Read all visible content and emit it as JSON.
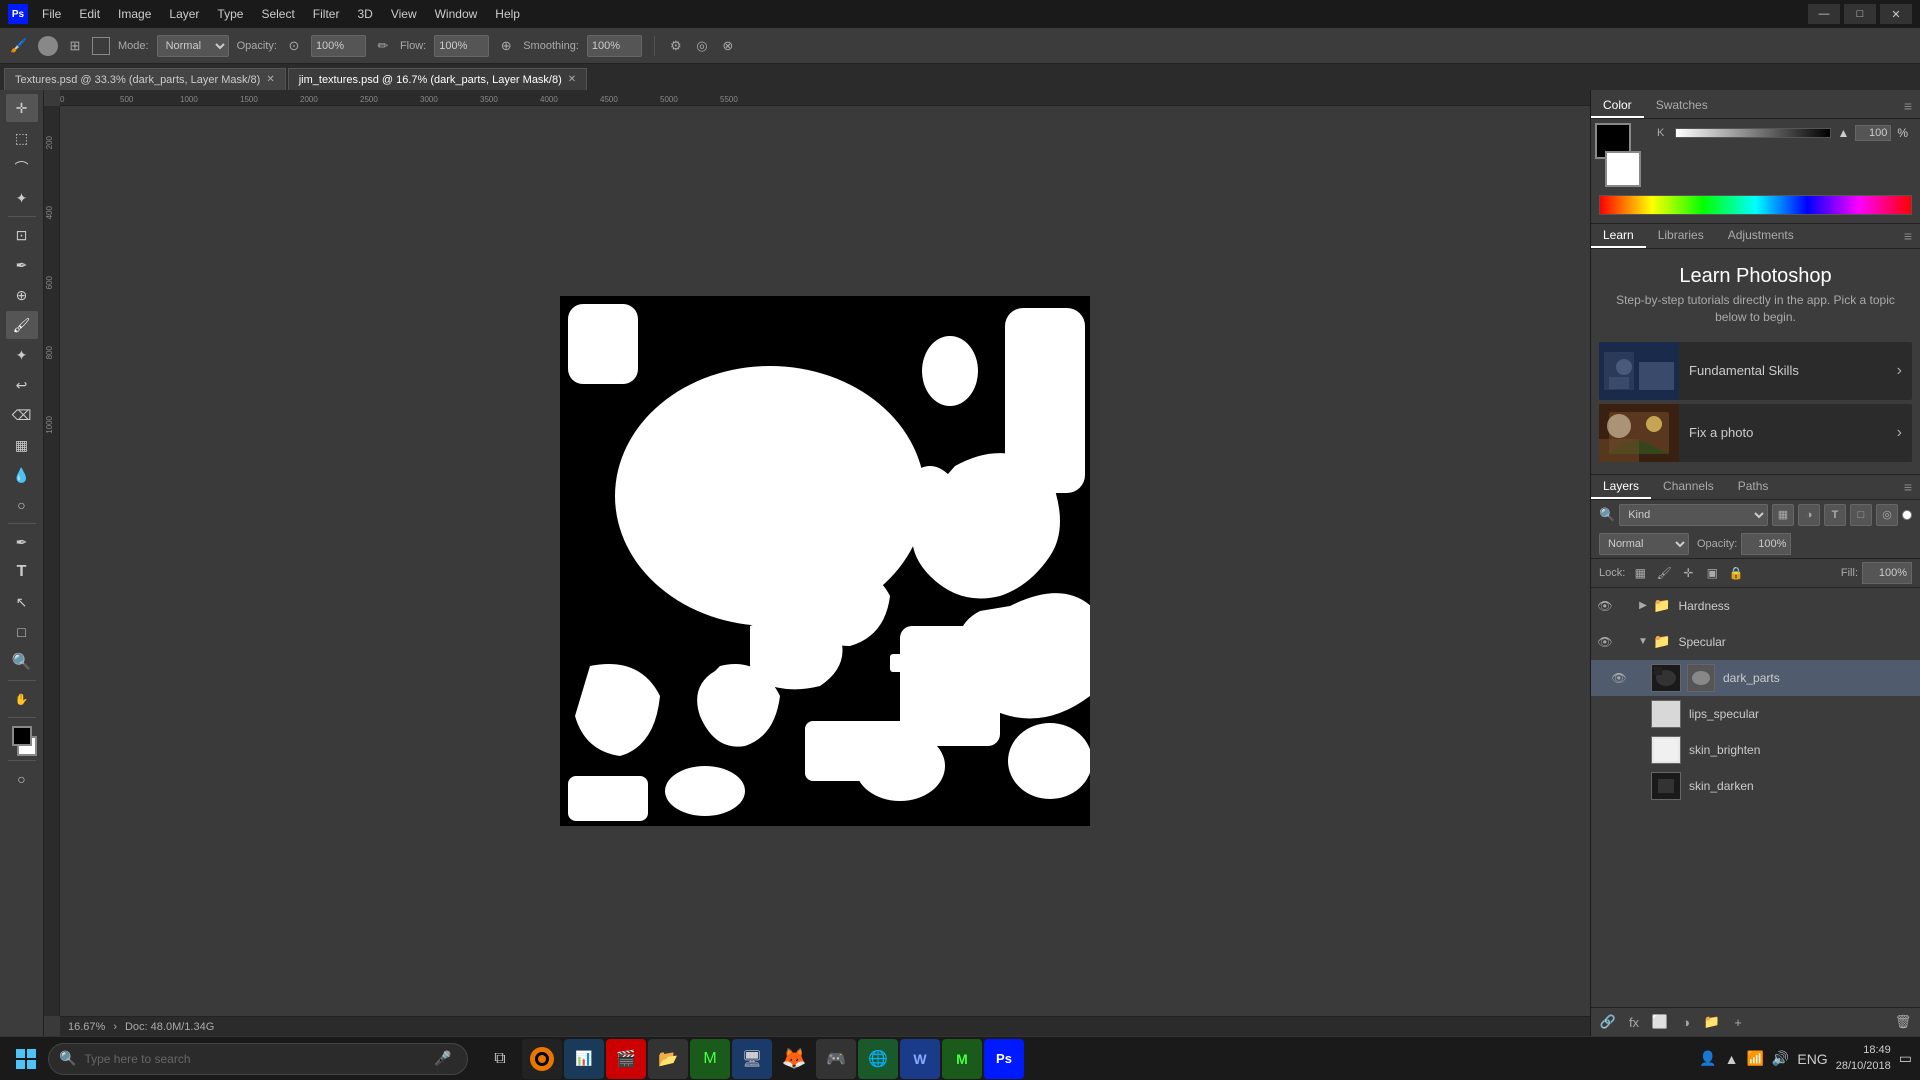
{
  "app": {
    "title": "Adobe Photoshop",
    "logo": "Ps"
  },
  "menus": [
    "File",
    "Edit",
    "Image",
    "Layer",
    "Type",
    "Select",
    "Filter",
    "3D",
    "View",
    "Window",
    "Help"
  ],
  "titlebar": {
    "minimize": "—",
    "maximize": "□",
    "close": "✕"
  },
  "optionsbar": {
    "mode_label": "Mode:",
    "mode_value": "Normal",
    "opacity_label": "Opacity:",
    "opacity_value": "100%",
    "flow_label": "Flow:",
    "flow_value": "100%",
    "smoothing_label": "Smoothing:",
    "smoothing_value": "100%"
  },
  "tabs": [
    {
      "name": "Textures.psd @ 33.3% (dark_parts, Layer Mask/8)",
      "active": false,
      "dirty": false
    },
    {
      "name": "jim_textures.psd @ 16.7% (dark_parts, Layer Mask/8)",
      "active": true,
      "dirty": true
    }
  ],
  "color_panel": {
    "tabs": [
      "Color",
      "Swatches"
    ],
    "active_tab": "Color",
    "k_label": "K",
    "k_value": "100",
    "percent": "%"
  },
  "learn_panel": {
    "tabs": [
      "Learn",
      "Libraries",
      "Adjustments"
    ],
    "active_tab": "Learn",
    "title": "Learn Photoshop",
    "subtitle": "Step-by-step tutorials directly in the app. Pick a topic below to begin.",
    "cards": [
      {
        "id": "fundamental",
        "label": "Fundamental Skills",
        "emoji": "🏠"
      },
      {
        "id": "fix-photo",
        "label": "Fix a photo",
        "emoji": "📷"
      }
    ]
  },
  "layers_panel": {
    "tabs": [
      "Layers",
      "Channels",
      "Paths"
    ],
    "active_tab": "Layers",
    "filter_label": "Kind",
    "mode": "Normal",
    "opacity_label": "Opacity:",
    "opacity_value": "100%",
    "lock_label": "Lock:",
    "fill_label": "Fill:",
    "fill_value": "100%",
    "layers": [
      {
        "id": "hardness",
        "name": "Hardness",
        "type": "group",
        "visible": true,
        "expanded": false,
        "indent": 0
      },
      {
        "id": "specular",
        "name": "Specular",
        "type": "group",
        "visible": true,
        "expanded": true,
        "indent": 0
      },
      {
        "id": "dark_parts",
        "name": "dark_parts",
        "type": "layer",
        "visible": true,
        "selected": true,
        "indent": 1,
        "thumb_color": "#222",
        "mask_color": "#888"
      },
      {
        "id": "lips_specular",
        "name": "lips_specular",
        "type": "layer",
        "visible": true,
        "indent": 1,
        "thumb_color": "#ddd",
        "mask_color": null
      },
      {
        "id": "skin_brighten",
        "name": "skin_brighten",
        "type": "layer",
        "visible": true,
        "indent": 1,
        "thumb_color": "#eee",
        "mask_color": null
      },
      {
        "id": "skin_darken",
        "name": "skin_darken",
        "type": "layer",
        "visible": true,
        "indent": 1,
        "thumb_color": "#333",
        "mask_color": null
      }
    ]
  },
  "status_bar": {
    "zoom": "16.67%",
    "doc_info": "Doc: 48.0M/1.34G"
  },
  "taskbar": {
    "search_placeholder": "Type here to search",
    "time": "18:49",
    "date": "28/10/2018",
    "lang": "ENG"
  }
}
